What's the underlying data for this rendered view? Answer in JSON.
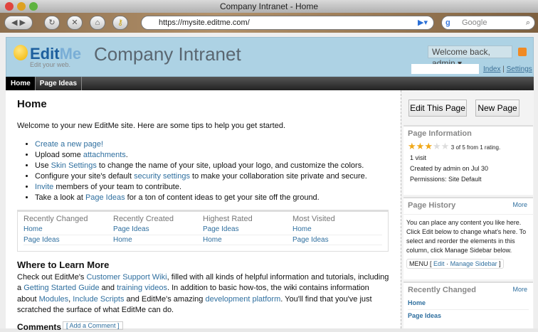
{
  "browser": {
    "title": "Company Intranet - Home",
    "url": "https://mysite.editme.com/",
    "search_placeholder": "Google"
  },
  "header": {
    "logo_edit": "Edit",
    "logo_me": "Me",
    "logo_tagline": "Edit your web.",
    "site_title": "Company Intranet",
    "welcome": "Welcome back, admin ▾",
    "index": "Index",
    "settings": "Settings",
    "sep": "|"
  },
  "nav": [
    {
      "label": "Home"
    },
    {
      "label": "Page Ideas"
    }
  ],
  "main": {
    "title": "Home",
    "intro": "Welcome to your new EditMe site. Here are some tips to help you get started.",
    "bullets": [
      [
        {
          "t": "Create a new page!",
          "link": true
        }
      ],
      [
        {
          "t": "Upload some "
        },
        {
          "t": "attachments",
          "link": true
        },
        {
          "t": "."
        }
      ],
      [
        {
          "t": "Use "
        },
        {
          "t": "Skin Settings",
          "link": true
        },
        {
          "t": " to change the name of your site, upload your logo, and customize the colors."
        }
      ],
      [
        {
          "t": "Configure your site's default "
        },
        {
          "t": "security settings",
          "link": true
        },
        {
          "t": " to make your collaboration site private and secure."
        }
      ],
      [
        {
          "t": "Invite",
          "link": true
        },
        {
          "t": " members of your team to contribute."
        }
      ],
      [
        {
          "t": "Take a look at "
        },
        {
          "t": "Page Ideas",
          "link": true
        },
        {
          "t": " for a ton of content ideas to get your site off the ground."
        }
      ]
    ],
    "lists": [
      {
        "heading": "Recently Changed",
        "items": [
          "Home",
          "Page Ideas"
        ]
      },
      {
        "heading": "Recently Created",
        "items": [
          "Page Ideas",
          "Home"
        ]
      },
      {
        "heading": "Highest Rated",
        "items": [
          "Page Ideas",
          "Home"
        ]
      },
      {
        "heading": "Most Visited",
        "items": [
          "Home",
          "Page Ideas"
        ]
      }
    ],
    "learn_title": "Where to Learn More",
    "learn": [
      {
        "t": "Check out EditMe's "
      },
      {
        "t": "Customer Support Wiki",
        "link": true
      },
      {
        "t": ", filled with all kinds of helpful information and tutorials, including a "
      },
      {
        "t": "Getting Started Guide",
        "link": true
      },
      {
        "t": " and "
      },
      {
        "t": "training videos",
        "link": true
      },
      {
        "t": ". In addition to basic how-tos, the wiki contains information about "
      },
      {
        "t": "Modules",
        "link": true
      },
      {
        "t": ", "
      },
      {
        "t": "Include Scripts",
        "link": true
      },
      {
        "t": " and EditMe's amazing "
      },
      {
        "t": "development platform",
        "link": true
      },
      {
        "t": ". You'll find that you've just scratched the surface of what EditMe can do."
      }
    ],
    "comments": "Comments",
    "add_comment": "[ Add a Comment ]"
  },
  "sidebar": {
    "edit_page": "Edit This Page",
    "new_page": "New Page",
    "info": {
      "title": "Page Information",
      "rating": 3,
      "rating_max": 5,
      "rating_text": "3 of 5 from 1 rating.",
      "visits": "1 visit",
      "created": "Created by admin on Jul 30",
      "permissions": "Permissions: Site Default"
    },
    "history": {
      "title": "Page History",
      "more": "More",
      "text": "You can place any content you like here. Click Edit below to change what's here. To select and reorder the elements in this column, click Manage Sidebar below.",
      "menu": "MENU [",
      "edit": "Edit",
      "dot": "·",
      "manage": "Manage Sidebar",
      "close": "]"
    },
    "recent": {
      "title": "Recently Changed",
      "more": "More",
      "items": [
        "Home",
        "Page Ideas"
      ]
    }
  }
}
